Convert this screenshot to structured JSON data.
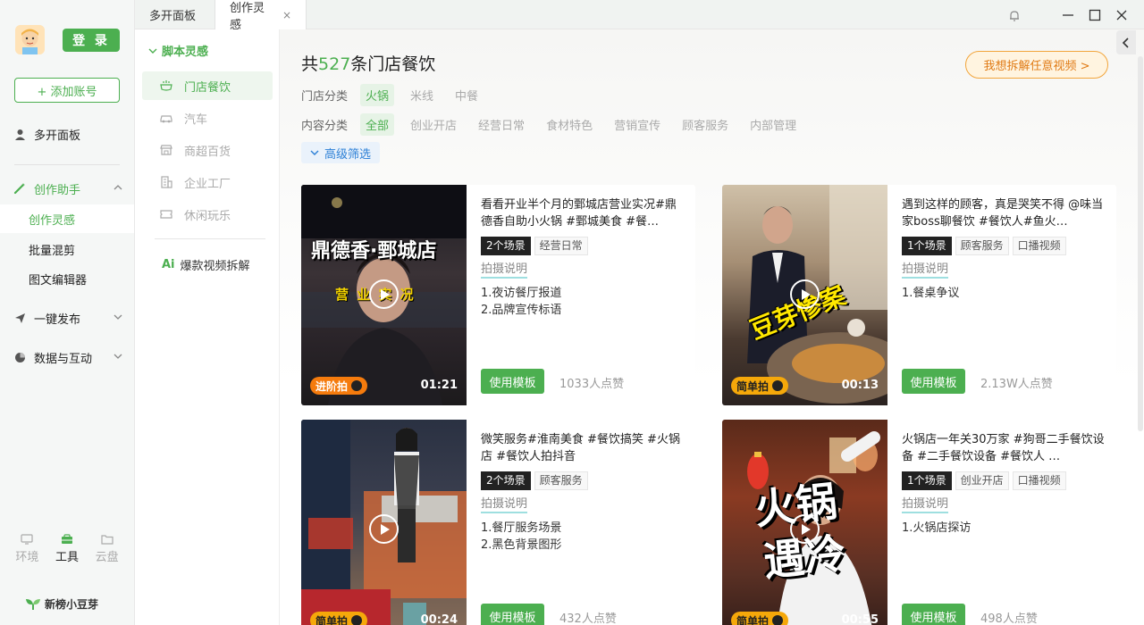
{
  "sidebar": {
    "login_label": "登 录",
    "add_account_label": "+ 添加账号",
    "multi_panel_label": "多开面板",
    "creation_assistant_label": "创作助手",
    "creation_sub": [
      "创作灵感",
      "批量混剪",
      "图文编辑器"
    ],
    "publish_label": "一键发布",
    "data_label": "数据与互动",
    "bottom_tabs": [
      "环境",
      "工具",
      "云盘"
    ],
    "brand": "新榜小豆芽",
    "accent": "#4caf50"
  },
  "tabs": {
    "multi_panel": "多开面板",
    "creation_inspiration": "创作灵感",
    "close_symbol": "×"
  },
  "categories": {
    "header": "脚本灵感",
    "items": [
      "门店餐饮",
      "汽车",
      "商超百货",
      "企业工厂",
      "休闲玩乐"
    ],
    "extra_prefix": "Ai",
    "extra_label": "爆款视频拆解"
  },
  "main": {
    "total_prefix": "共",
    "total_count": "527",
    "total_suffix": "条门店餐饮",
    "store_filter_label": "门店分类",
    "store_chips": [
      "火锅",
      "米线",
      "中餐"
    ],
    "content_filter_label": "内容分类",
    "content_chips": [
      "全部",
      "创业开店",
      "经营日常",
      "食材特色",
      "营销宣传",
      "顾客服务",
      "内部管理"
    ],
    "advanced_filter": "高级筛选",
    "decon_button": "我想拆解任意视频 >",
    "shoot_link": "拍摄说明",
    "use_template": "使用模板"
  },
  "cards": [
    {
      "title": "看看开业半个月的鄄城店营业实况#鼎德香自助小火锅 #鄄城美食 #餐…",
      "scene_tag": "2个场景",
      "tags": [
        "经营日常"
      ],
      "points": [
        "1.夜访餐厅报道",
        "2.品牌宣传标语"
      ],
      "likes": "1033人点赞",
      "level": "进阶拍",
      "duration": "01:21",
      "overlay_main": "鼎德香·鄄城店",
      "overlay_sub": "营 业 实 况"
    },
    {
      "title": "遇到这样的顾客，真是哭笑不得 @味当家boss聊餐饮 #餐饮人#鱼火…",
      "scene_tag": "1个场景",
      "tags": [
        "顾客服务",
        "口播视频"
      ],
      "points": [
        "1.餐桌争议"
      ],
      "likes": "2.13W人点赞",
      "level": "简单拍",
      "duration": "00:13",
      "overlay_main": "豆芽惨案",
      "overlay_sub": ""
    },
    {
      "title": "微笑服务#淮南美食 #餐饮搞笑 #火锅店 #餐饮人拍抖音",
      "scene_tag": "2个场景",
      "tags": [
        "顾客服务"
      ],
      "points": [
        "1.餐厅服务场景",
        "2.黑色背景图形"
      ],
      "likes": "432人点赞",
      "level": "简单拍",
      "duration": "00:24",
      "overlay_main": "",
      "overlay_sub": ""
    },
    {
      "title": "火锅店一年关30万家 #狗哥二手餐饮设备 #二手餐饮设备 #餐饮人 …",
      "scene_tag": "1个场景",
      "tags": [
        "创业开店",
        "口播视频"
      ],
      "points": [
        "1.火锅店探访"
      ],
      "likes": "498人点赞",
      "level": "简单拍",
      "duration": "00:55",
      "overlay_main": "火锅",
      "overlay_sub": "遇冷"
    }
  ]
}
